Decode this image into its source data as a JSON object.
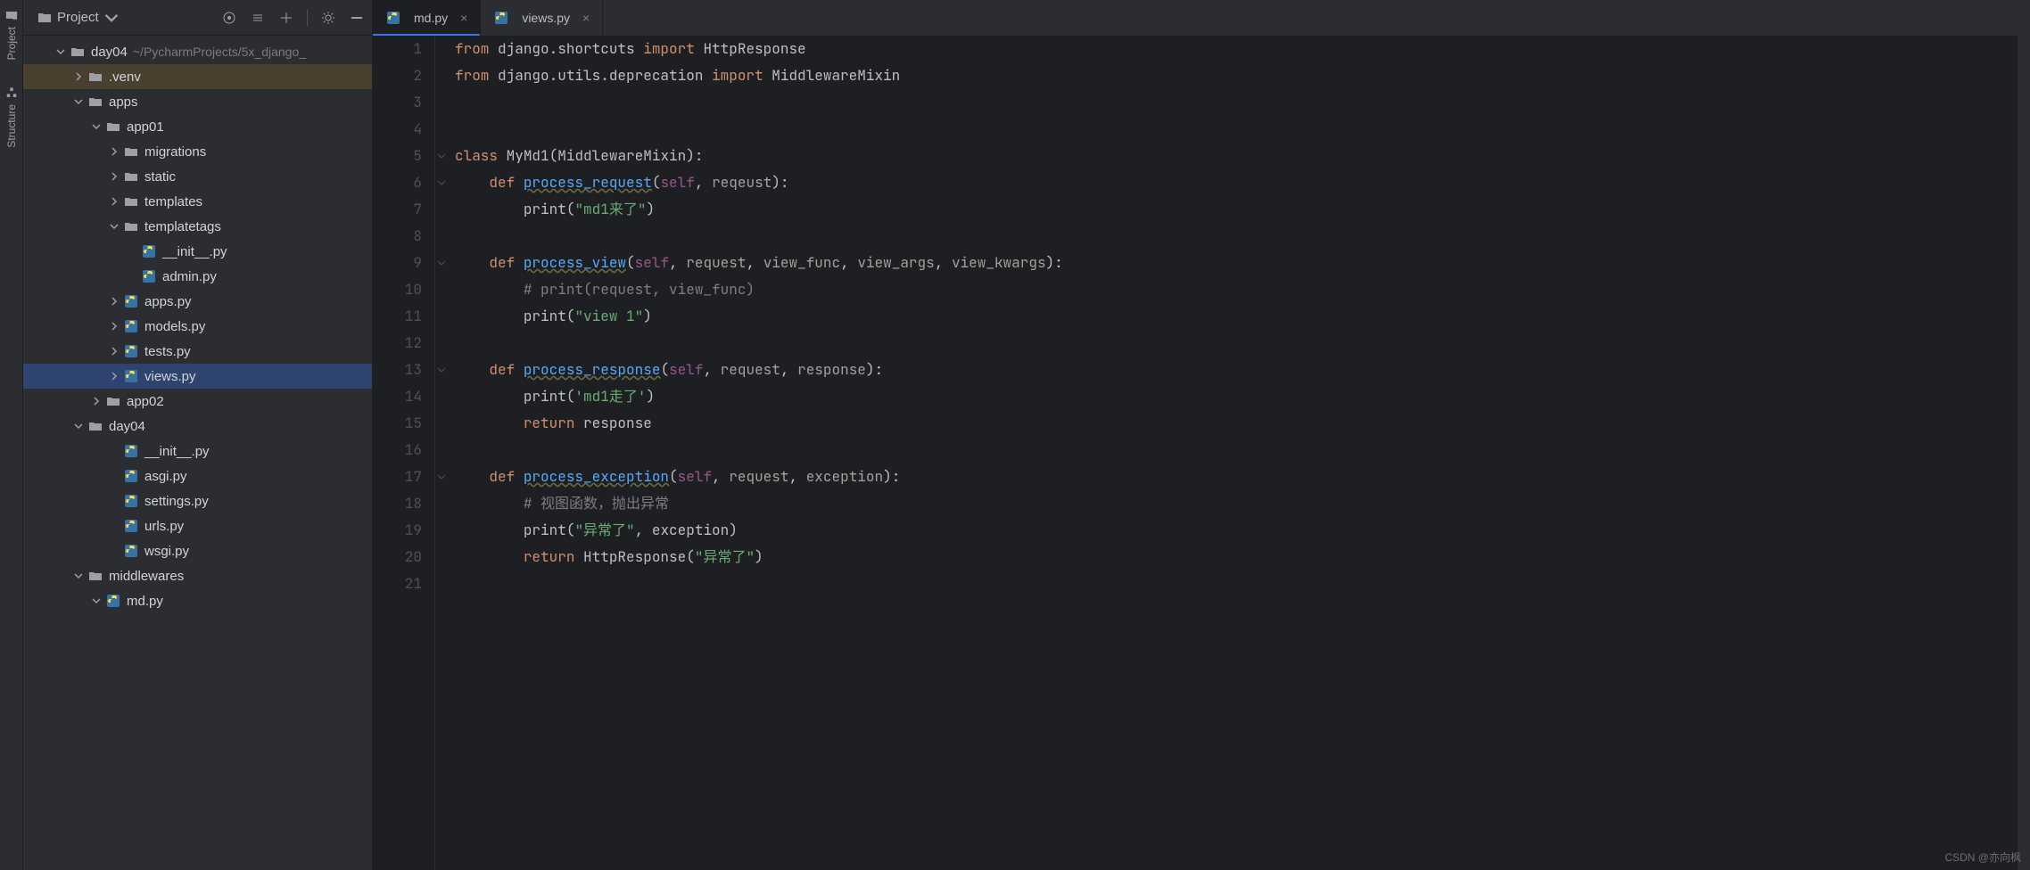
{
  "rail": {
    "project": "Project",
    "structure": "Structure"
  },
  "sidebar": {
    "project_label": "Project",
    "root": {
      "name": "day04",
      "path": "~/PycharmProjects/5x_django_"
    },
    "items": [
      {
        "depth": 1,
        "chev": "down",
        "icon": "folder",
        "name": "day04",
        "path": "~/PycharmProjects/5x_django_",
        "sel": ""
      },
      {
        "depth": 2,
        "chev": "right",
        "icon": "folder",
        "name": ".venv",
        "sel": "brown"
      },
      {
        "depth": 2,
        "chev": "down",
        "icon": "folder",
        "name": "apps"
      },
      {
        "depth": 3,
        "chev": "down",
        "icon": "folder",
        "name": "app01"
      },
      {
        "depth": 4,
        "chev": "right",
        "icon": "folder",
        "name": "migrations"
      },
      {
        "depth": 4,
        "chev": "right",
        "icon": "folder",
        "name": "static"
      },
      {
        "depth": 4,
        "chev": "right",
        "icon": "folder",
        "name": "templates"
      },
      {
        "depth": 4,
        "chev": "down",
        "icon": "folder",
        "name": "templatetags"
      },
      {
        "depth": 5,
        "chev": "",
        "icon": "py",
        "name": "__init__.py"
      },
      {
        "depth": 5,
        "chev": "",
        "icon": "py",
        "name": "admin.py"
      },
      {
        "depth": 4,
        "chev": "right",
        "icon": "py",
        "name": "apps.py"
      },
      {
        "depth": 4,
        "chev": "right",
        "icon": "py",
        "name": "models.py"
      },
      {
        "depth": 4,
        "chev": "right",
        "icon": "py",
        "name": "tests.py"
      },
      {
        "depth": 4,
        "chev": "right",
        "icon": "py",
        "name": "views.py",
        "sel": "blue"
      },
      {
        "depth": 3,
        "chev": "right",
        "icon": "folder",
        "name": "app02"
      },
      {
        "depth": 2,
        "chev": "down",
        "icon": "folder",
        "name": "day04"
      },
      {
        "depth": 4,
        "chev": "",
        "icon": "py",
        "name": "__init__.py"
      },
      {
        "depth": 4,
        "chev": "",
        "icon": "py",
        "name": "asgi.py"
      },
      {
        "depth": 4,
        "chev": "",
        "icon": "py",
        "name": "settings.py"
      },
      {
        "depth": 4,
        "chev": "",
        "icon": "py",
        "name": "urls.py"
      },
      {
        "depth": 4,
        "chev": "",
        "icon": "py",
        "name": "wsgi.py"
      },
      {
        "depth": 2,
        "chev": "down",
        "icon": "folder",
        "name": "middlewares"
      },
      {
        "depth": 3,
        "chev": "down",
        "icon": "py",
        "name": "md.py"
      }
    ]
  },
  "tabs": [
    {
      "name": "md.py",
      "active": true
    },
    {
      "name": "views.py",
      "active": false
    }
  ],
  "code": {
    "lines": [
      {
        "n": 1,
        "fold": "▸",
        "html": "<span class='kw'>from</span> <span class='cls'>django.shortcuts</span> <span class='kw'>import</span> <span class='cls'>HttpResponse</span>"
      },
      {
        "n": 2,
        "fold": "▸",
        "html": "<span class='kw'>from</span> <span class='cls'>django.utils.deprecation</span> <span class='kw'>import</span> <span class='cls'>MiddlewareMixin</span>"
      },
      {
        "n": 3,
        "fold": "",
        "html": ""
      },
      {
        "n": 4,
        "fold": "",
        "html": ""
      },
      {
        "n": 5,
        "fold": "▾",
        "html": "<span class='kw'>class</span> <span class='cls'>MyMd1</span><span class='op'>(</span><span class='cls'>MiddlewareMixin</span><span class='op'>):</span>"
      },
      {
        "n": 6,
        "fold": "▾",
        "html": "    <span class='kw'>def</span> <span class='fn-u'>process_request</span><span class='op'>(</span><span class='self'>self</span><span class='op'>,</span> <span class='par'>reqeust</span><span class='op'>):</span>"
      },
      {
        "n": 7,
        "fold": "▴",
        "html": "        <span class='call'>print</span><span class='op'>(</span><span class='str'>\"md1来了\"</span><span class='op'>)</span>"
      },
      {
        "n": 8,
        "fold": "",
        "html": ""
      },
      {
        "n": 9,
        "fold": "▾",
        "html": "    <span class='kw'>def</span> <span class='fn-u'>process_view</span><span class='op'>(</span><span class='self'>self</span><span class='op'>,</span> <span class='par'>request</span><span class='op'>,</span> <span class='par'>view_func</span><span class='op'>,</span> <span class='par'>view_args</span><span class='op'>,</span> <span class='par'>view_kwargs</span><span class='op'>):</span>"
      },
      {
        "n": 10,
        "fold": "",
        "html": "        <span class='com'># print(request, view_func)</span>"
      },
      {
        "n": 11,
        "fold": "▴",
        "html": "        <span class='call'>print</span><span class='op'>(</span><span class='str'>\"view 1\"</span><span class='op'>)</span>"
      },
      {
        "n": 12,
        "fold": "",
        "html": ""
      },
      {
        "n": 13,
        "fold": "▾",
        "html": "    <span class='kw'>def</span> <span class='fn-u'>process_response</span><span class='op'>(</span><span class='self'>self</span><span class='op'>,</span> <span class='par'>request</span><span class='op'>,</span> <span class='par'>response</span><span class='op'>):</span>"
      },
      {
        "n": 14,
        "fold": "",
        "html": "        <span class='call'>print</span><span class='op'>(</span><span class='str'>'md1走了'</span><span class='op'>)</span>"
      },
      {
        "n": 15,
        "fold": "▴",
        "html": "        <span class='kw'>return</span> <span class='cls'>response</span>"
      },
      {
        "n": 16,
        "fold": "",
        "html": ""
      },
      {
        "n": 17,
        "fold": "▾",
        "html": "    <span class='kw'>def</span> <span class='fn-u'>process_exception</span><span class='op'>(</span><span class='self'>self</span><span class='op'>,</span> <span class='par'>request</span><span class='op'>,</span> <span class='par'>exception</span><span class='op'>):</span>"
      },
      {
        "n": 18,
        "fold": "",
        "html": "        <span class='com'># 视图函数，抛出异常</span>"
      },
      {
        "n": 19,
        "fold": "",
        "html": "        <span class='call'>print</span><span class='op'>(</span><span class='str'>\"异常了\"</span><span class='op'>,</span> <span class='cls'>exception</span><span class='op'>)</span>"
      },
      {
        "n": 20,
        "fold": "",
        "html": "        <span class='kw'>return</span> <span class='cls'>HttpResponse</span><span class='op'>(</span><span class='str'>\"异常了\"</span><span class='op'>)</span>"
      },
      {
        "n": 21,
        "fold": "",
        "html": ""
      }
    ]
  },
  "watermark": "CSDN @亦向枫"
}
